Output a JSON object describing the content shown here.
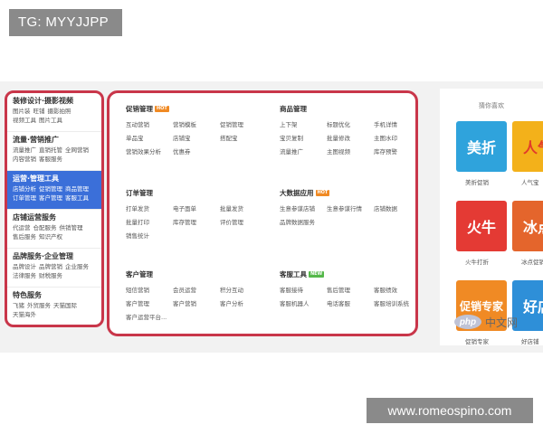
{
  "watermark_top": "TG: MYYJJPP",
  "watermark_bottom": "www.romeospino.com",
  "sidebar": {
    "groups": [
      {
        "title": "装修设计·摄影视频",
        "lines": [
          [
            "图片装",
            "旺铺",
            "摄影拍照"
          ],
          [
            "视频工具",
            "图片工具"
          ]
        ],
        "active": false
      },
      {
        "title": "流量·营销推广",
        "lines": [
          [
            "流量推广",
            "直销托管",
            "全网营销"
          ],
          [
            "内容营销",
            "客服服务"
          ]
        ],
        "active": false
      },
      {
        "title": "运营·管理工具",
        "lines": [
          [
            "店铺分析",
            "促销管理",
            "商品管理"
          ],
          [
            "订单管理",
            "客户管理",
            "客服工具"
          ]
        ],
        "active": true
      },
      {
        "title": "店铺运营服务",
        "lines": [
          [
            "代运营",
            "仓配服务",
            "供销管理"
          ],
          [
            "售后服务",
            "知识产权"
          ]
        ],
        "active": false
      },
      {
        "title": "品牌服务·企业管理",
        "lines": [
          [
            "品牌设计",
            "品牌营销",
            "企业服务"
          ],
          [
            "法律服务",
            "财税服务"
          ]
        ],
        "active": false
      },
      {
        "title": "特色服务",
        "lines": [
          [
            "飞猪",
            "外贸服务",
            "天猫国际"
          ],
          [
            "天猫海外"
          ]
        ],
        "active": false
      }
    ]
  },
  "main": {
    "sections": [
      {
        "title": "促销管理",
        "tag": "HOT",
        "items": [
          "互动营销",
          "营销模板",
          "促销管理",
          "单品宝",
          "店铺宝",
          "搭配宝",
          "营销效果分析",
          "优惠券"
        ]
      },
      {
        "title": "商品管理",
        "tag": "",
        "items": [
          "上下架",
          "标题优化",
          "手机详情",
          "宝贝复制",
          "批量修改",
          "主图水印",
          "流量推广",
          "主图视频",
          "库存预警"
        ]
      },
      {
        "title": "订单管理",
        "tag": "",
        "items": [
          "打单发货",
          "电子面单",
          "批量发货",
          "批量打印",
          "库存管理",
          "评价管理",
          "销售统计"
        ]
      },
      {
        "title": "大数据应用",
        "tag": "HOT",
        "items": [
          "生意参谋店铺",
          "生意参谋行情",
          "店铺数据",
          "品牌数据服务"
        ]
      },
      {
        "title": "客户管理",
        "tag": "",
        "items": [
          "短信营销",
          "会员运营",
          "积分互动",
          "客户管理",
          "客户营销",
          "客户分析",
          "客户运营平台..."
        ]
      },
      {
        "title": "客服工具",
        "tag": "NEW",
        "items": [
          "客服接待",
          "售后管理",
          "客服绩效",
          "客服机器人",
          "电话客服",
          "客服培训系统"
        ]
      }
    ]
  },
  "recommend": {
    "title": "猜你喜欢",
    "tiles": [
      {
        "text": "美折",
        "caption": "美折促销",
        "bg": "#2fa3dc",
        "fg": "#ffffff"
      },
      {
        "text": "人气",
        "caption": "人气宝",
        "bg": "#f3b11a",
        "fg": "#e23a2a"
      },
      {
        "text": "火牛",
        "caption": "火牛打折",
        "bg": "#e43a34",
        "fg": "#ffffff"
      },
      {
        "text": "冰点",
        "caption": "冰点促销",
        "bg": "#e4652c",
        "fg": "#ffffff"
      },
      {
        "text": "促销专家",
        "caption": "促销专家",
        "bg": "#f08a24",
        "fg": "#ffffff"
      },
      {
        "text": "好店",
        "caption": "好店铺",
        "bg": "#2e8fd8",
        "fg": "#ffffff"
      }
    ]
  },
  "php_mark": {
    "logo": "php",
    "text": "中文网"
  },
  "colors": {
    "highlight_border": "#c9364a",
    "active_group": "#3b6fd9"
  }
}
